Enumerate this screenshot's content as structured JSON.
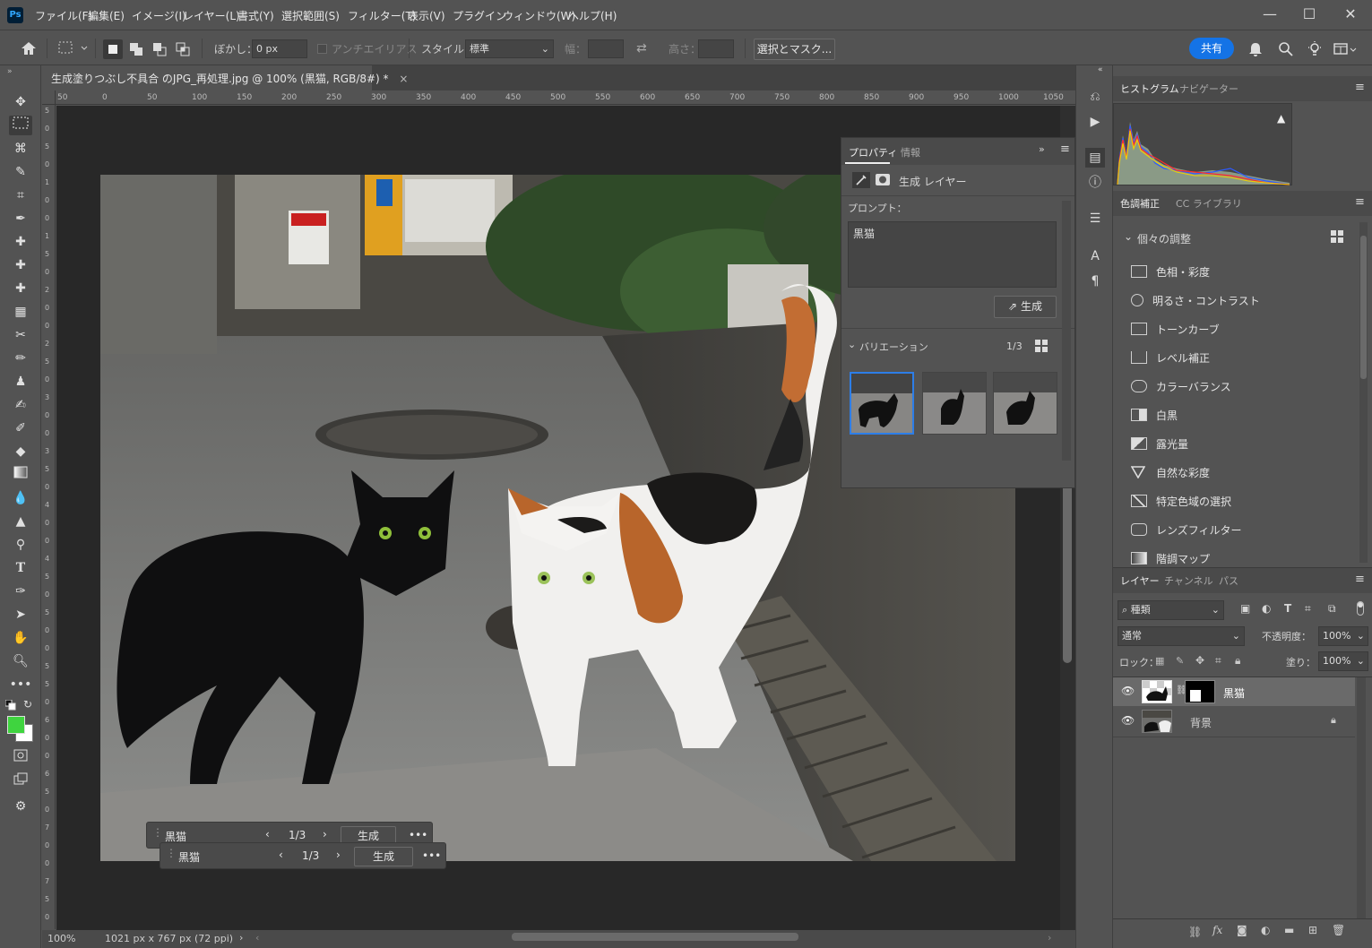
{
  "app": {
    "logo": "Ps"
  },
  "menu": [
    "ファイル(F)",
    "編集(E)",
    "イメージ(I)",
    "レイヤー(L)",
    "書式(Y)",
    "選択範囲(S)",
    "フィルター(T)",
    "表示(V)",
    "プラグイン",
    "ウィンドウ(W)",
    "ヘルプ(H)"
  ],
  "window": {
    "minimize": "—",
    "maximize": "☐",
    "close": "✕"
  },
  "options": {
    "feather_label": "ぼかし：",
    "feather_value": "0 px",
    "antialias": "アンチエイリアス",
    "style_label": "スタイル：",
    "style_value": "標準",
    "width_label": "幅：",
    "height_label": "高さ：",
    "select_mask": "選択とマスク...",
    "share": "共有"
  },
  "document": {
    "tab_title": "生成塗りつぶし不具合 のJPG_再処理.jpg @ 100% (黒猫, RGB/8#) *",
    "close": "×",
    "zoom": "100%",
    "info": "1021 px x 767 px (72 ppi)",
    "ruler_top": [
      "50",
      "0",
      "50",
      "100",
      "150",
      "200",
      "250",
      "300",
      "350",
      "400",
      "450",
      "500",
      "550",
      "600",
      "650",
      "700",
      "750",
      "800",
      "850",
      "900",
      "950",
      "1000",
      "1050"
    ],
    "ruler_left": [
      "5",
      "0",
      "5",
      "0",
      "1",
      "0",
      "0",
      "1",
      "5",
      "0",
      "2",
      "0",
      "0",
      "2",
      "5",
      "0",
      "3",
      "0",
      "0",
      "3",
      "5",
      "0",
      "4",
      "0",
      "0",
      "4",
      "5",
      "0",
      "5",
      "0",
      "0",
      "5",
      "5",
      "0",
      "6",
      "0",
      "0",
      "6",
      "5",
      "0",
      "7",
      "0",
      "0",
      "7",
      "5",
      "0"
    ]
  },
  "properties": {
    "tabs": [
      "プロパティ",
      "情報"
    ],
    "layer_type": "生成 レイヤー",
    "prompt_label": "プロンプト：",
    "prompt_value": "黒猫",
    "generate": "生成",
    "variations_label": "バリエーション",
    "variations_count": "1/3"
  },
  "contextbar": {
    "prompt1": "黒猫",
    "count1": "1/3",
    "generate1": "生成",
    "prompt2": "黒猫",
    "count2": "1/3",
    "generate2": "生成",
    "more": "•••"
  },
  "right": {
    "tabs_top": [
      "ヒストグラム",
      "ナビゲーター"
    ],
    "tabs_adj": [
      "色調補正",
      "CC ライブラリ"
    ],
    "adj_group": "個々の調整",
    "adjustments": [
      "色相・彩度",
      "明るさ・コントラスト",
      "トーンカーブ",
      "レベル補正",
      "カラーバランス",
      "白黒",
      "露光量",
      "自然な彩度",
      "特定色域の選択",
      "レンズフィルター",
      "階調マップ"
    ],
    "tabs_layers": [
      "レイヤー",
      "チャンネル",
      "パス"
    ],
    "filter_kind": "種類",
    "blend_mode": "通常",
    "opacity_label": "不透明度：",
    "opacity_value": "100%",
    "lock_label": "ロック：",
    "fill_label": "塗り：",
    "fill_value": "100%",
    "layers": [
      {
        "name": "黒猫"
      },
      {
        "name": "背景"
      }
    ]
  },
  "colors": {
    "accent": "#1473e6",
    "foreground": "#3fd43f",
    "background": "#ffffff"
  }
}
